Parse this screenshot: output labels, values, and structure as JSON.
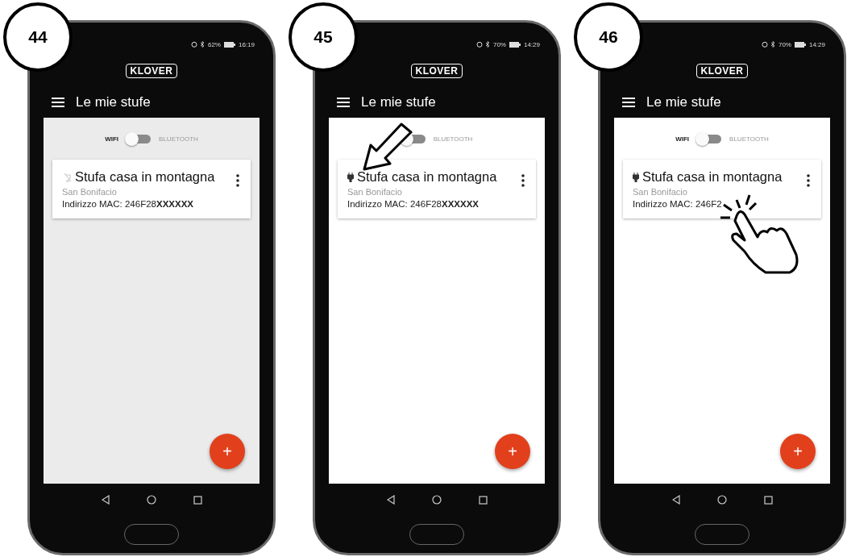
{
  "phones": [
    {
      "step": "44",
      "battery": "62%",
      "time": "16:19",
      "logo": "KLOVER",
      "title": "Le mie stufe",
      "wifi_label": "WIFI",
      "bluetooth_label": "BLUETOOTH",
      "bluetooth_on": false,
      "connected": false,
      "card": {
        "name": "Stufa casa in montagna",
        "location": "San Bonifacio",
        "mac": "Indirizzo MAC: 246F28**XXXXXX**"
      },
      "fab": "+"
    },
    {
      "step": "45",
      "battery": "70%",
      "time": "14:29",
      "logo": "KLOVER",
      "title": "Le mie stufe",
      "bluetooth_label": "BLUETOOTH",
      "bluetooth_on": false,
      "connected": true,
      "card": {
        "name": "Stufa casa in montagna",
        "location": "San Bonifacio",
        "mac": "Indirizzo MAC: 246F28**XXXXXX**"
      },
      "fab": "+",
      "overlay": {
        "kind": "arrow"
      }
    },
    {
      "step": "46",
      "battery": "70%",
      "time": "14:29",
      "logo": "KLOVER",
      "title": "Le mie stufe",
      "wifi_label": "WIFI",
      "bluetooth_label": "BLUETOOTH",
      "bluetooth_on": false,
      "connected": true,
      "card": {
        "name": "Stufa casa in montagna",
        "location": "San Bonifacio",
        "mac": "Indirizzo MAC: 246F2"
      },
      "fab": "+",
      "overlay": {
        "kind": "tap"
      }
    }
  ]
}
